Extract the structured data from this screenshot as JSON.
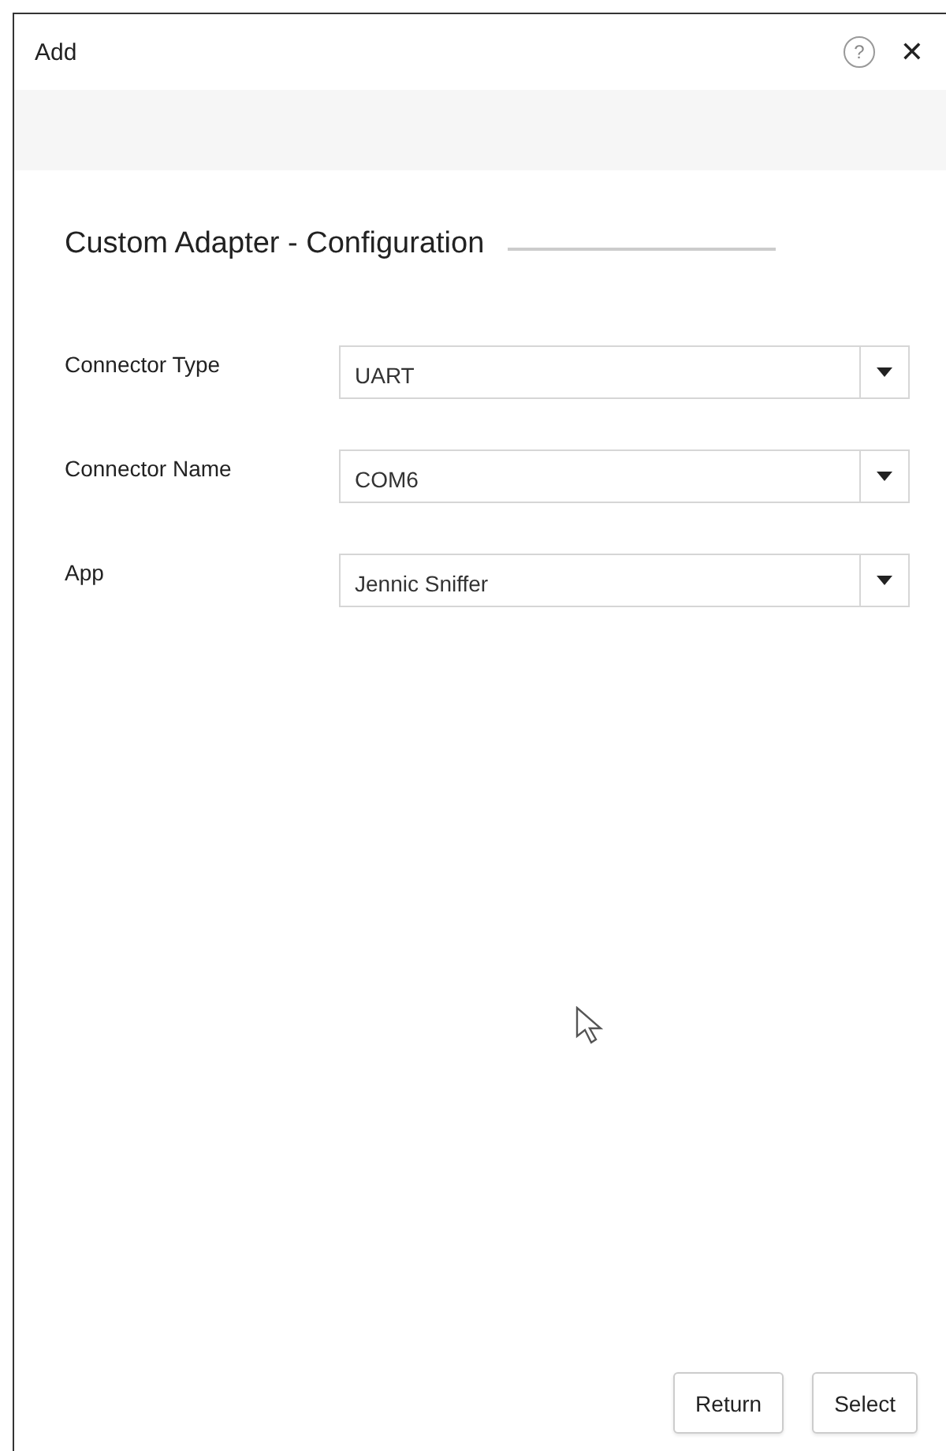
{
  "window": {
    "title": "Add",
    "help_icon": "?",
    "close_icon": "✕"
  },
  "section_title": "Custom Adapter - Configuration",
  "fields": [
    {
      "label": "Connector Type",
      "value": "UART"
    },
    {
      "label": "Connector Name",
      "value": "COM6"
    },
    {
      "label": "App",
      "value": "Jennic Sniffer"
    }
  ],
  "buttons": [
    "Return",
    "Select"
  ]
}
